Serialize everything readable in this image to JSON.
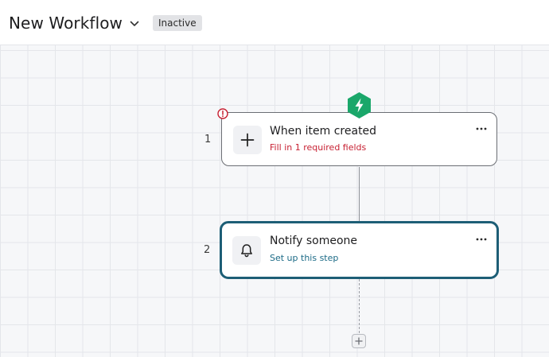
{
  "header": {
    "title": "New Workflow",
    "status_badge": "Inactive",
    "icons": {
      "dropdown": "chevron-down-icon"
    }
  },
  "workflow": {
    "steps": [
      {
        "number": "1",
        "title": "When item created",
        "subtitle": "Fill in 1 required fields",
        "icon": "plus-icon",
        "status": "error",
        "trigger_icon": "lightning-bolt-icon"
      },
      {
        "number": "2",
        "title": "Notify someone",
        "subtitle": "Set up this step",
        "icon": "bell-icon",
        "status": "selected"
      }
    ],
    "add_step_icon": "plus-icon"
  },
  "colors": {
    "accent": "#1d5e76",
    "trigger": "#1aa76a",
    "error": "#c72032",
    "link": "#1b6a86",
    "badge_bg": "#e2e3e6",
    "canvas_bg": "#f6f7f9"
  }
}
